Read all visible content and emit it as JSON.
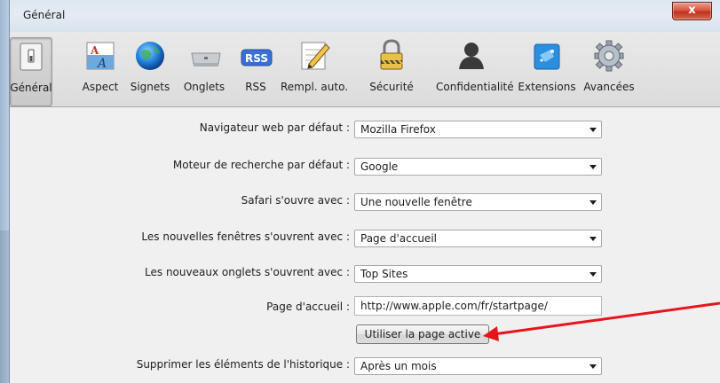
{
  "window": {
    "title": "Général",
    "close_label": "x"
  },
  "toolbar": {
    "items": [
      {
        "label": "Général",
        "icon": "switch-icon",
        "selected": true
      },
      {
        "label": "Aspect",
        "icon": "font-icon"
      },
      {
        "label": "Signets",
        "icon": "globe-icon"
      },
      {
        "label": "Onglets",
        "icon": "tabs-icon"
      },
      {
        "label": "RSS",
        "icon": "rss-icon",
        "badge": "RSS"
      },
      {
        "label": "Rempl. auto.",
        "icon": "pencil-form-icon"
      },
      {
        "label": "Sécurité",
        "icon": "lock-icon"
      },
      {
        "label": "Confidentialité",
        "icon": "person-silhouette-icon"
      },
      {
        "label": "Extensions",
        "icon": "puzzle-icon"
      },
      {
        "label": "Avancées",
        "icon": "gear-icon"
      }
    ]
  },
  "form": {
    "default_browser": {
      "label": "Navigateur web par défaut :",
      "value": "Mozilla Firefox"
    },
    "search_engine": {
      "label": "Moteur de recherche par défaut :",
      "value": "Google"
    },
    "safari_opens": {
      "label": "Safari s'ouvre avec :",
      "value": "Une nouvelle fenêtre"
    },
    "new_windows": {
      "label": "Les nouvelles fenêtres s'ouvrent avec :",
      "value": "Page d'accueil"
    },
    "new_tabs": {
      "label": "Les nouveaux onglets s'ouvrent avec :",
      "value": "Top Sites"
    },
    "homepage": {
      "label": "Page d'accueil :",
      "value": "http://www.apple.com/fr/startpage/"
    },
    "use_current_page_button": "Utiliser la page active",
    "remove_history": {
      "label": "Supprimer les éléments de l'historique :",
      "value": "Après un mois"
    }
  },
  "colors": {
    "annotation_arrow": "#e8141c"
  }
}
